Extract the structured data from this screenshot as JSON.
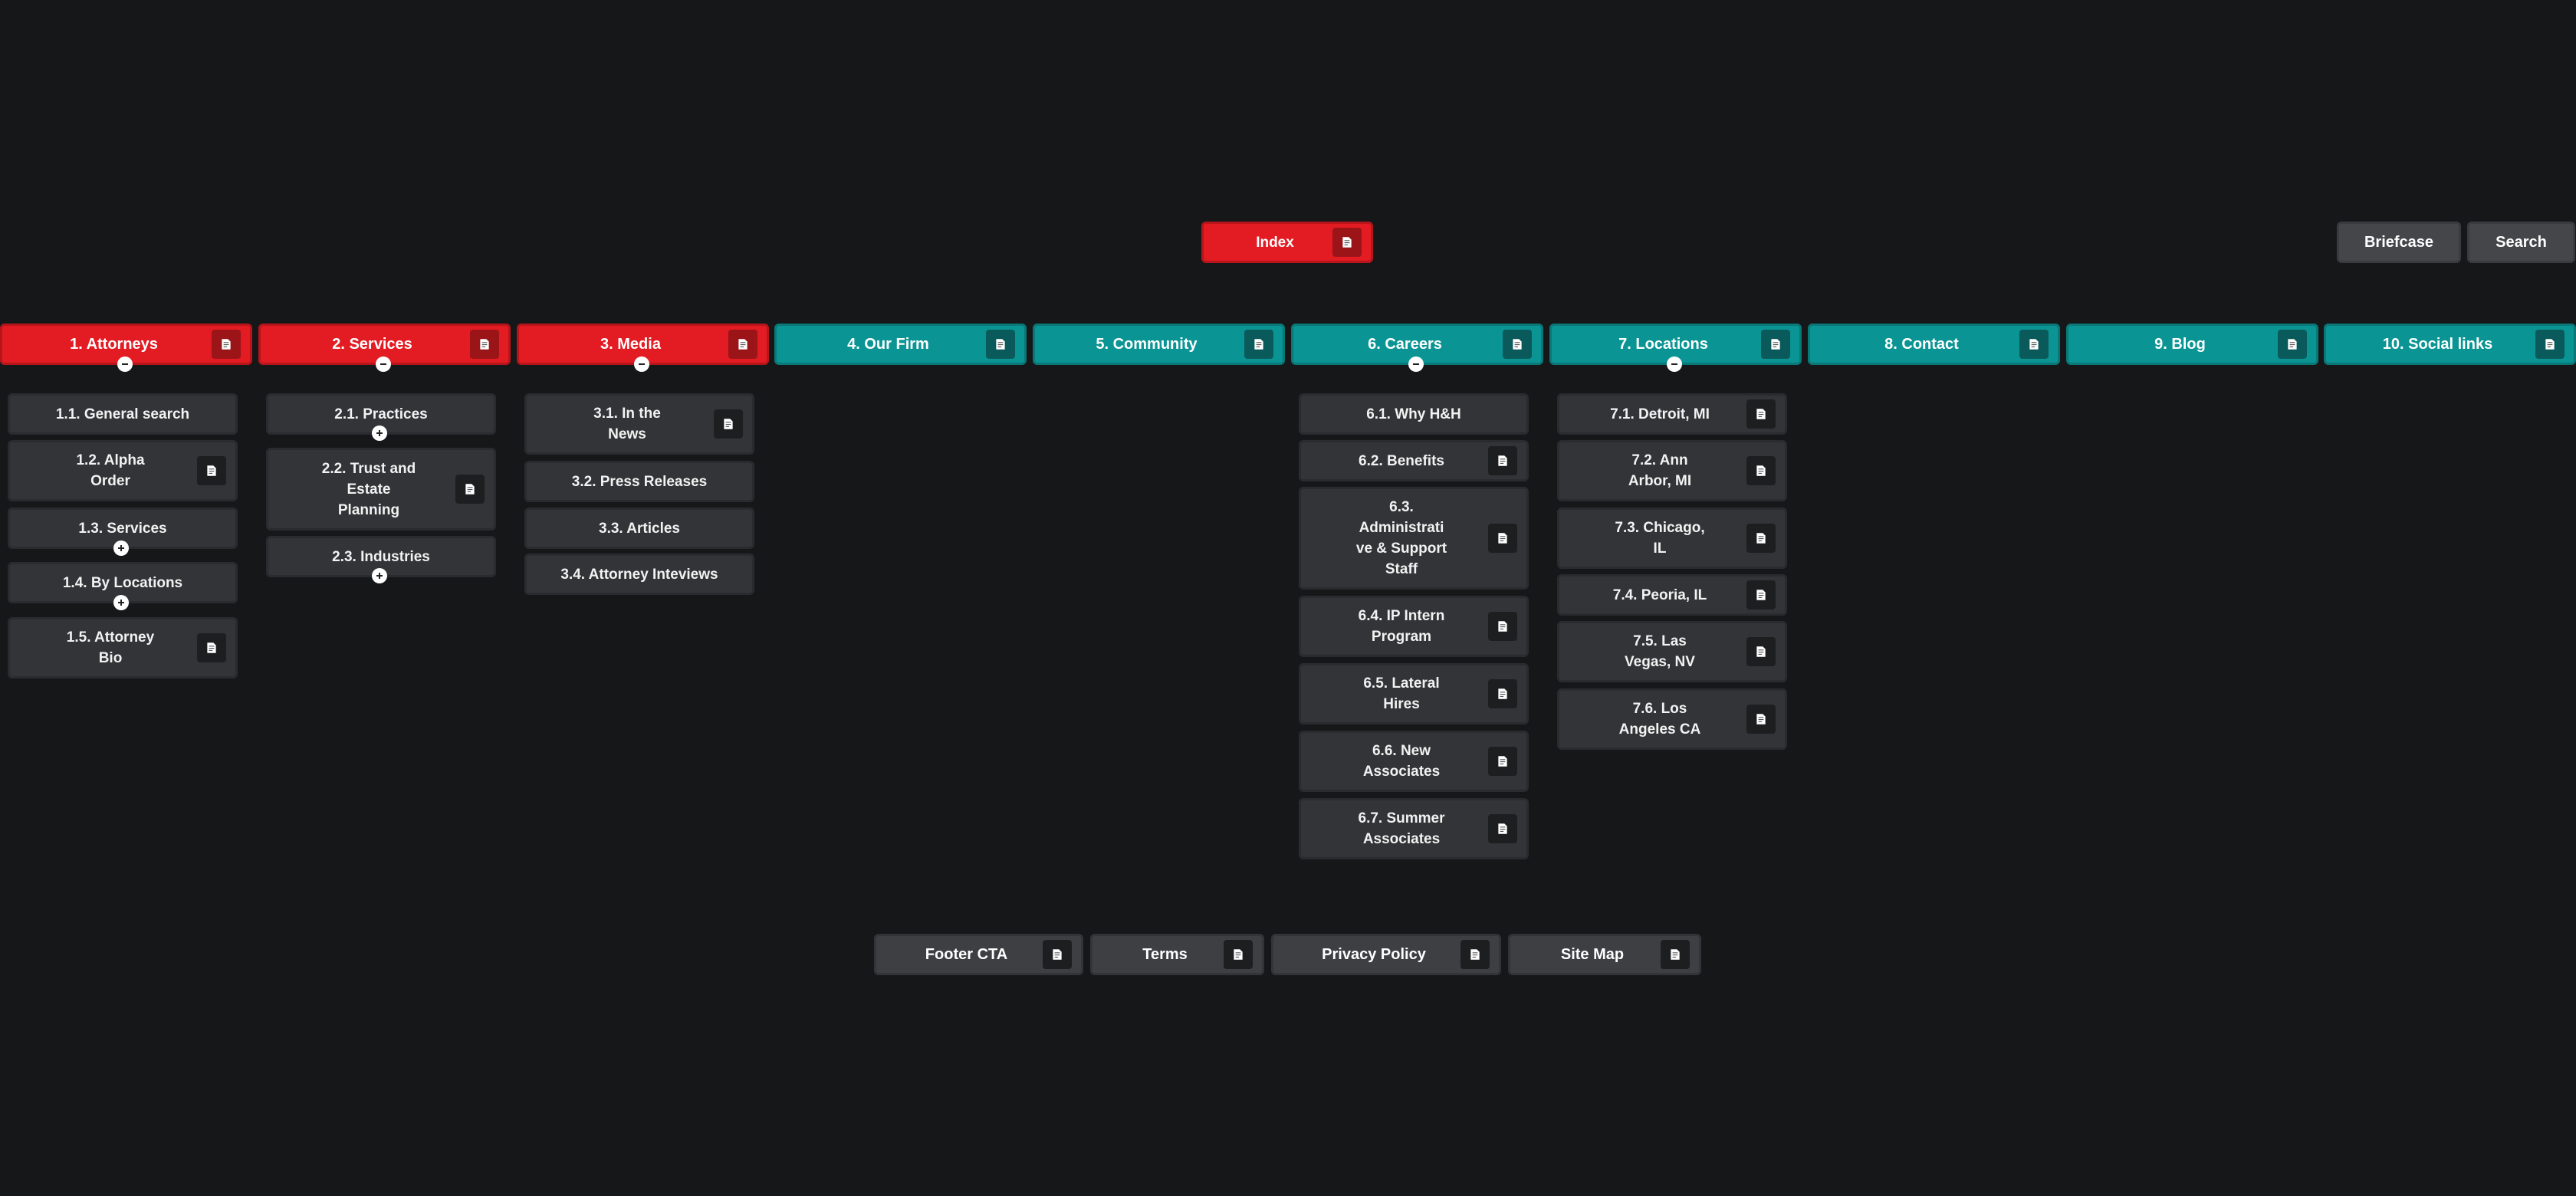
{
  "root": {
    "label": "Index"
  },
  "utility": {
    "briefcase": "Briefcase",
    "search": "Search"
  },
  "sections": {
    "s1": {
      "label": "1. Attorneys"
    },
    "s2": {
      "label": "2. Services"
    },
    "s3": {
      "label": "3. Media"
    },
    "s4": {
      "label": "4. Our Firm"
    },
    "s5": {
      "label": "5. Community"
    },
    "s6": {
      "label": "6. Careers"
    },
    "s7": {
      "label": "7. Locations"
    },
    "s8": {
      "label": "8. Contact"
    },
    "s9": {
      "label": "9. Blog"
    },
    "s10": {
      "label": "10. Social links"
    }
  },
  "children": {
    "c1_1": "1.1. General search",
    "c1_2": "1.2. Alpha\nOrder",
    "c1_3": "1.3. Services",
    "c1_4": "1.4. By Locations",
    "c1_5": "1.5. Attorney\nBio",
    "c2_1": "2.1. Practices",
    "c2_2": "2.2. Trust and\nEstate\nPlanning",
    "c2_3": "2.3. Industries",
    "c3_1": "3.1. In the\nNews",
    "c3_2": "3.2. Press Releases",
    "c3_3": "3.3. Articles",
    "c3_4": "3.4. Attorney Inteviews",
    "c6_1": "6.1. Why H&H",
    "c6_2": "6.2. Benefits",
    "c6_3": "6.3.\nAdministrati\nve & Support\nStaff",
    "c6_4": "6.4. IP Intern\nProgram",
    "c6_5": "6.5. Lateral\nHires",
    "c6_6": "6.6. New\nAssociates",
    "c6_7": "6.7. Summer\nAssociates",
    "c7_1": "7.1. Detroit, MI",
    "c7_2": "7.2. Ann\nArbor, MI",
    "c7_3": "7.3. Chicago,\nIL",
    "c7_4": "7.4. Peoria, IL",
    "c7_5": "7.5. Las\nVegas, NV",
    "c7_6": "7.6. Los\nAngeles CA"
  },
  "footer": {
    "cta": "Footer CTA",
    "terms": "Terms",
    "privacy": "Privacy Policy",
    "sitemap": "Site Map"
  },
  "icons": {
    "page": "page-icon",
    "collapse": "minus-circle-icon",
    "expand": "plus-circle-icon"
  },
  "colors": {
    "background": "#161719",
    "active_section": "#e31b23",
    "section": "#0a9494",
    "child": "#333437",
    "utility": "#45464a"
  }
}
